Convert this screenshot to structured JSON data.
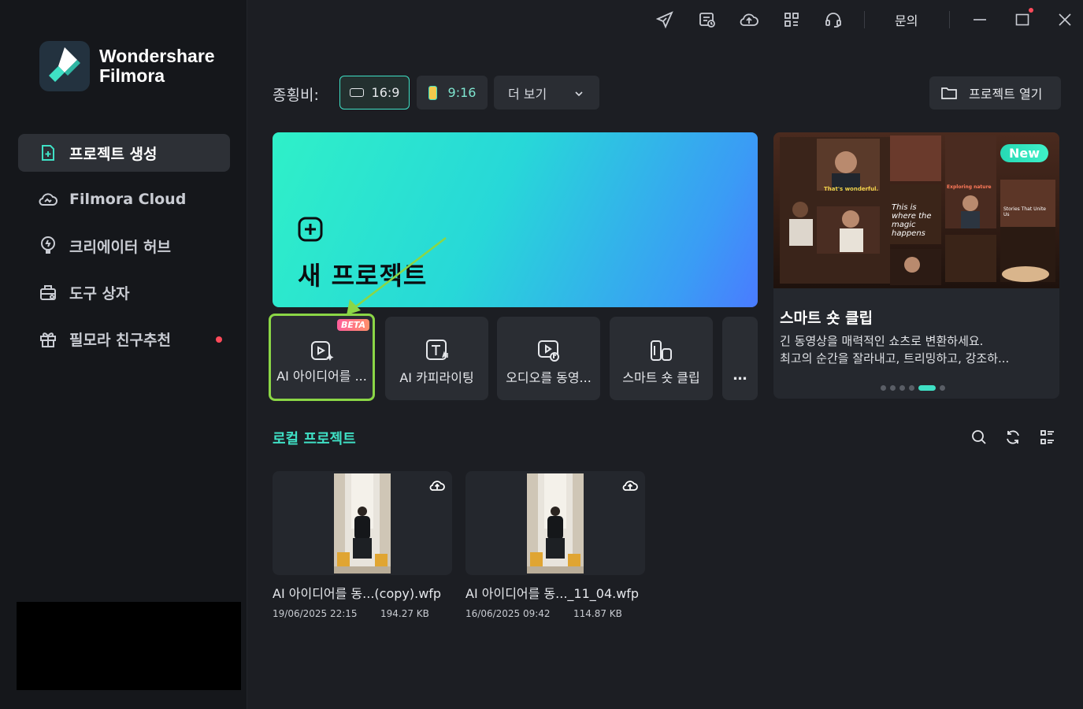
{
  "app": {
    "brand_line1": "Wondershare",
    "brand_line2": "Filmora"
  },
  "sidebar": {
    "items": [
      {
        "label": "프로젝트 생성",
        "icon": "new-project-icon",
        "active": true
      },
      {
        "label": "Filmora Cloud",
        "icon": "cloud-icon"
      },
      {
        "label": "크리에이터 허브",
        "icon": "lightbulb-icon"
      },
      {
        "label": "도구 상자",
        "icon": "toolbox-icon"
      },
      {
        "label": "필모라 친구추천",
        "icon": "gift-icon",
        "badge_dot": true
      }
    ]
  },
  "topbar": {
    "icons": [
      "send-icon",
      "tasks-icon",
      "cloud-upload-icon",
      "apps-grid-icon",
      "headset-icon"
    ],
    "inquiry_label": "문의",
    "window_controls": [
      "minimize-icon",
      "maximize-icon",
      "close-icon"
    ]
  },
  "aspect": {
    "label": "종횡비:",
    "options": [
      {
        "label": "16:9",
        "selected": true
      },
      {
        "label": "9:16"
      }
    ],
    "more_label": "더 보기",
    "open_project_label": "프로젝트 열기"
  },
  "hero": {
    "title": "새 프로젝트"
  },
  "tools": [
    {
      "label": "AI 아이디어를 ...",
      "badge": "BETA",
      "icon": "ai-idea-video-icon"
    },
    {
      "label": "AI 카피라이팅",
      "icon": "ai-text-icon"
    },
    {
      "label": "오디오를 동영...",
      "icon": "audio-to-video-icon"
    },
    {
      "label": "스마트 숏 클립",
      "icon": "smart-short-clip-icon"
    },
    {
      "label": "…",
      "icon": "more-icon"
    }
  ],
  "promo": {
    "badge": "New",
    "title": "스마트 숏 클립",
    "desc_line1": "긴 동영상을 매력적인 쇼츠로 변환하세요.",
    "desc_line2": "최고의 순간을 잘라내고, 트리밍하고, 강조하...",
    "thumb_texts": [
      "That's wonderful.",
      "This is where the magic happens",
      "Exploring nature",
      "Stories That Unite Us"
    ],
    "slide_count": 6,
    "active_slide": 4
  },
  "local_projects": {
    "title": "로컬 프로젝트",
    "tools": [
      "search-icon",
      "refresh-icon",
      "list-view-icon"
    ],
    "items": [
      {
        "name": "AI 아이디어를 동...(copy).wfp",
        "date": "19/06/2025 22:15",
        "size": "194.27 KB"
      },
      {
        "name": "AI 아이디어를 동..._11_04.wfp",
        "date": "16/06/2025 09:42",
        "size": "114.87 KB"
      }
    ]
  }
}
